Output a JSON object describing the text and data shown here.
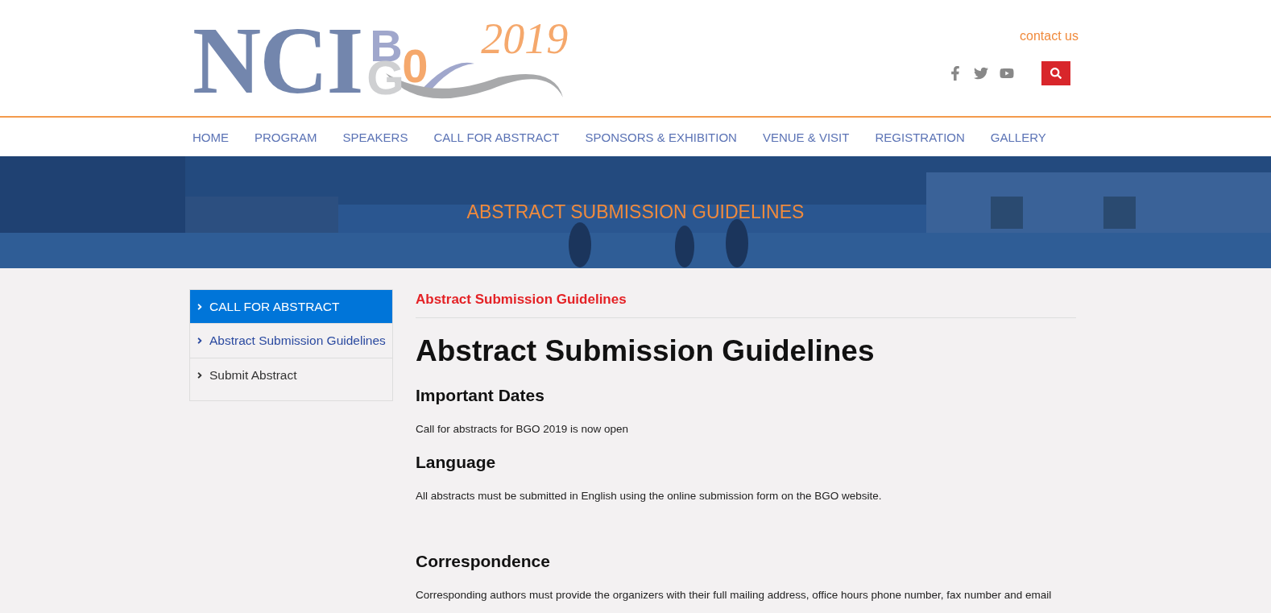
{
  "logo": {
    "main": "NCI",
    "letters": [
      "B",
      "G",
      "0"
    ],
    "year": "2019"
  },
  "header": {
    "contact": "contact us"
  },
  "nav": [
    {
      "label": "HOME",
      "selected": false
    },
    {
      "label": "PROGRAM",
      "selected": false
    },
    {
      "label": "SPEAKERS",
      "selected": false
    },
    {
      "label": "CALL FOR ABSTRACT",
      "selected": false
    },
    {
      "label": "SPONSORS & EXHIBITION",
      "selected": false
    },
    {
      "label": "VENUE & VISIT",
      "selected": false
    },
    {
      "label": "REGISTRATION",
      "selected": false
    },
    {
      "label": "GALLERY",
      "selected": false
    }
  ],
  "banner": {
    "kind": "picture",
    "title": "ABSTRACT SUBMISSION GUIDELINES"
  },
  "sidebar": {
    "items": [
      {
        "label": "CALL FOR ABSTRACT",
        "selected": true
      },
      {
        "label": "Abstract Submission Guidelines",
        "selected": false,
        "current": true
      },
      {
        "label": "Submit Abstract",
        "selected": false,
        "current": false
      }
    ]
  },
  "content": {
    "breadcrumb": "Abstract Submission Guidelines",
    "title": "Abstract Submission Guidelines",
    "sections": [
      {
        "heading": "Important Dates",
        "text": "Call for abstracts for BGO 2019 is now open"
      },
      {
        "heading": "Language",
        "text": "All abstracts must be submitted in English using the online submission form on the BGO website."
      },
      {
        "heading": "Correspondence",
        "text": "Corresponding authors must provide the organizers with their full mailing address, office hours phone number, fax number and email"
      }
    ]
  }
}
